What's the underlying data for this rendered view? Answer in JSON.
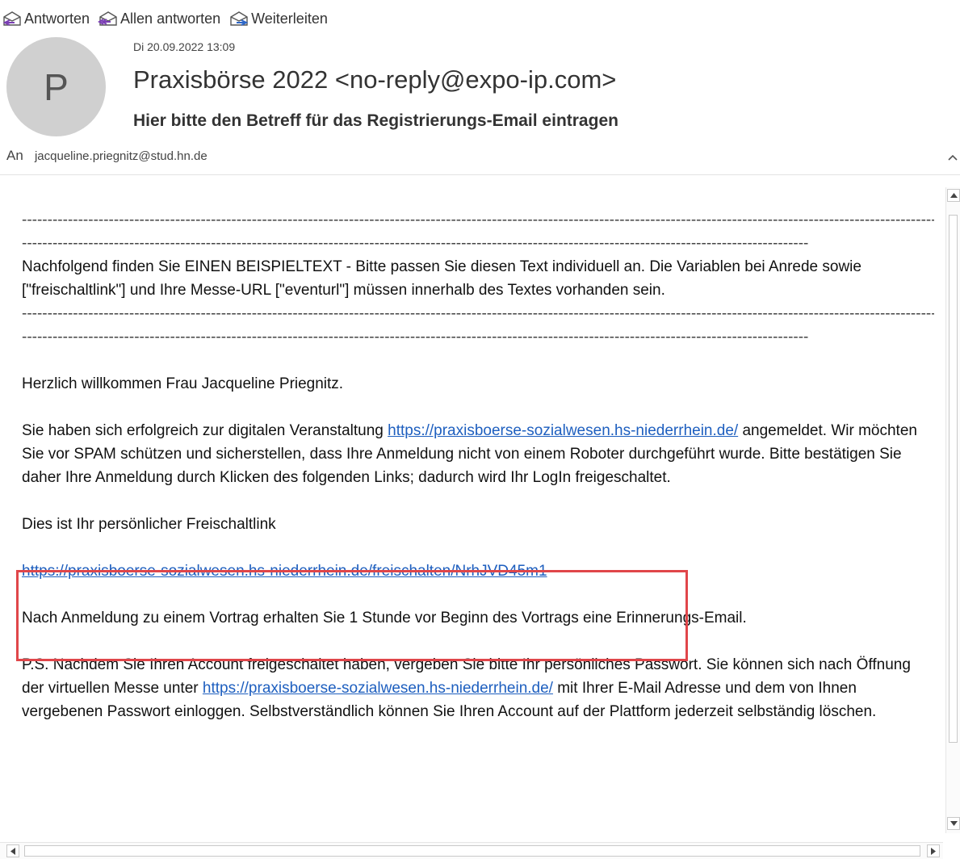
{
  "toolbar": {
    "reply": "Antworten",
    "reply_all": "Allen antworten",
    "forward": "Weiterleiten"
  },
  "header": {
    "avatar_letter": "P",
    "date": "Di 20.09.2022 13:09",
    "sender": "Praxisbörse 2022 <no-reply@expo-ip.com>",
    "subject": "Hier bitte den Betreff für das Registrierungs-Email eintragen",
    "to_label": "An",
    "to_address": "jacqueline.priegnitz@stud.hn.de",
    "collapse_icon": "chevron-up-icon"
  },
  "body": {
    "dash_line_1": "------------------------------------------------------------------------------------------------------------------------------------------------------------------------------------------------------------------------------------------------------",
    "dash_line_2": "----------------------------------------------------------------------------------------------------------------------------------------------------------",
    "notice": "Nachfolgend finden Sie EINEN BEISPIELTEXT - Bitte passen Sie diesen Text individuell an. Die Variablen bei Anrede sowie [\"freischaltlink\"] und Ihre Messe-URL [\"eventurl\"] müssen innerhalb des Textes vorhanden sein.",
    "dash_line_3": "------------------------------------------------------------------------------------------------------------------------------------------------------------------------------------------------------------------------------------------------------",
    "dash_line_4": "----------------------------------------------------------------------------------------------------------------------------------------------------------",
    "greeting": "Herzlich willkommen Frau  Jacqueline Priegnitz.",
    "para1_before": "Sie haben sich erfolgreich zur digitalen Veranstaltung  ",
    "event_link": "https://praxisboerse-sozialwesen.hs-niederrhein.de/",
    "para1_after": " angemeldet. Wir möchten Sie vor SPAM schützen und sicherstellen, dass Ihre Anmeldung nicht von einem Roboter durchgeführt wurde. Bitte bestätigen Sie daher Ihre Anmeldung durch Klicken des folgenden Links; dadurch wird Ihr  LogIn freigeschaltet.",
    "link_intro": "Dies ist Ihr persönlicher Freischaltlink",
    "activation_link": "https://praxisboerse-sozialwesen.hs-niederrhein.de/freischalten/NrhJVD45m1",
    "reminder": "Nach Anmeldung zu einem Vortrag erhalten Sie 1 Stunde vor Beginn des Vortrags eine Erinnerungs-Email.",
    "ps_before": "P.S. Nachdem Sie Ihren Account freigeschaltet haben, vergeben Sie bitte Ihr persönliches Passwort. Sie können sich nach Öffnung der virtuellen Messe unter  ",
    "ps_link": "https://praxisboerse-sozialwesen.hs-niederrhein.de/",
    "ps_after": " mit Ihrer E-Mail Adresse und dem von Ihnen vergebenen Passwort einloggen. Selbstverständlich können Sie Ihren Account auf der Plattform jederzeit selbständig löschen."
  },
  "colors": {
    "link": "#1e5fbf",
    "highlight_border": "#e0464a",
    "avatar_bg": "#d0d0d0"
  }
}
